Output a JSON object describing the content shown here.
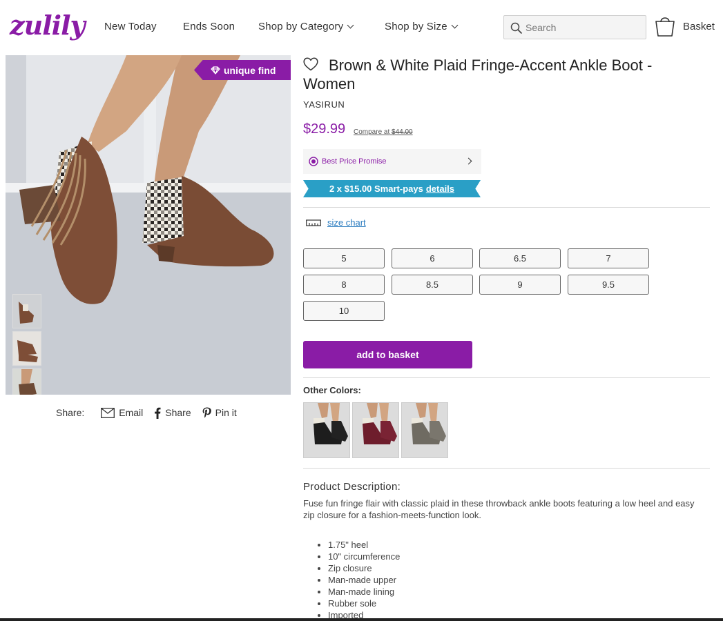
{
  "header": {
    "logo": "zulily",
    "nav": [
      {
        "label": "New Today",
        "dropdown": false
      },
      {
        "label": "Ends Soon",
        "dropdown": false
      },
      {
        "label": "Shop by Category",
        "dropdown": true
      },
      {
        "label": "Shop by Size",
        "dropdown": true
      }
    ],
    "search_placeholder": "Search",
    "basket_label": "Basket"
  },
  "gallery": {
    "badge": "unique find",
    "thumbnails": [
      "boot-view-1",
      "boot-view-2",
      "boot-view-3",
      "boot-view-4"
    ]
  },
  "share": {
    "label": "Share:",
    "email": "Email",
    "facebook": "Share",
    "pinterest": "Pin it"
  },
  "product": {
    "title": "Brown & White Plaid Fringe-Accent Ankle Boot - Women",
    "brand": "YASIRUN",
    "price": "$29.99",
    "compare_label": "Compare at",
    "compare_price": "$44.00",
    "best_price": "Best Price Promise",
    "smartpay_text": "2 x $15.00 Smart-pays",
    "smartpay_link": "details",
    "size_chart": "size chart",
    "sizes": [
      "5",
      "6",
      "6.5",
      "7",
      "8",
      "8.5",
      "9",
      "9.5",
      "10"
    ],
    "add_to_basket": "add to basket",
    "other_colors_label": "Other Colors:",
    "other_colors": [
      "black",
      "burgundy",
      "grey"
    ],
    "description_heading": "Product Description:",
    "description": "Fuse fun fringe flair with classic plaid in these throwback ankle boots featuring a low heel and easy zip closure for a fashion-meets-function look.",
    "features": [
      "1.75\" heel",
      "10\" circumference",
      "Zip closure",
      "Man-made upper",
      "Man-made lining",
      "Rubber sole",
      "Imported"
    ]
  },
  "colors": {
    "brand_purple": "#8a1ca6",
    "smartpay_blue": "#2a9fc6",
    "link_blue": "#2a7bbf"
  }
}
